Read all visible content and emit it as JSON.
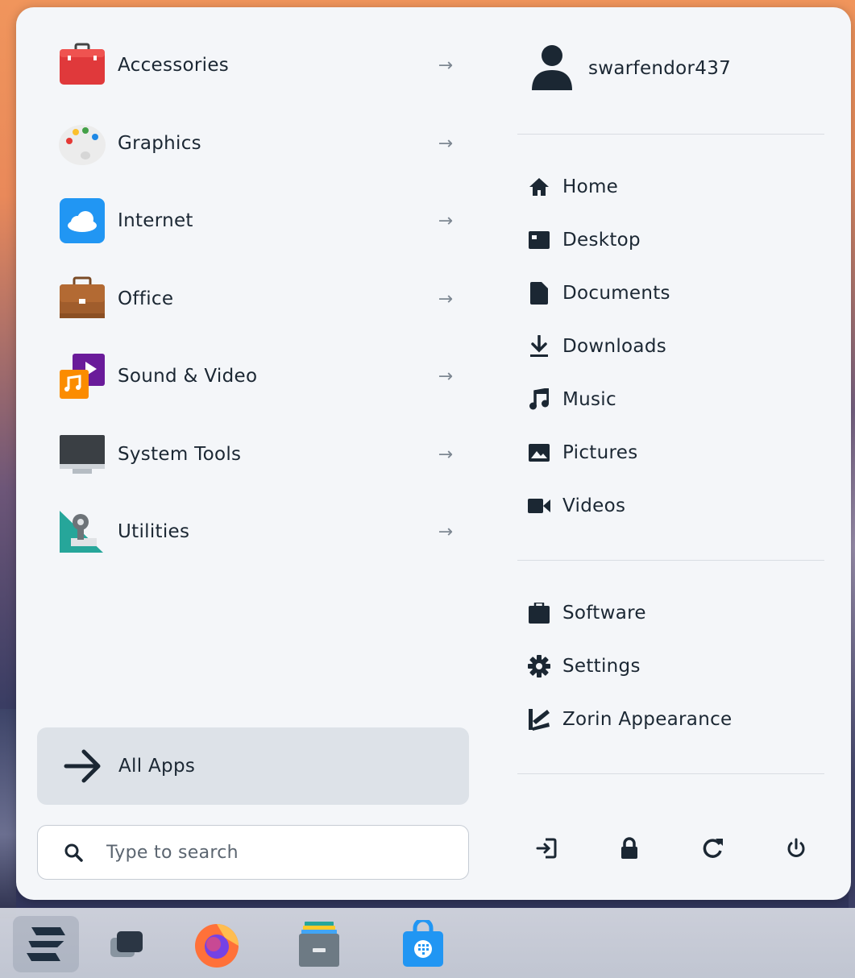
{
  "menu": {
    "categories": [
      {
        "label": "Accessories",
        "icon": "toolbox-icon"
      },
      {
        "label": "Graphics",
        "icon": "palette-icon"
      },
      {
        "label": "Internet",
        "icon": "cloud-icon"
      },
      {
        "label": "Office",
        "icon": "briefcase-icon"
      },
      {
        "label": "Sound & Video",
        "icon": "media-icon"
      },
      {
        "label": "System Tools",
        "icon": "monitor-icon"
      },
      {
        "label": "Utilities",
        "icon": "utilities-icon"
      }
    ],
    "arrow_glyph": "→",
    "all_apps_label": "All Apps",
    "search_placeholder": "Type to search"
  },
  "user": {
    "name": "swarfendor437"
  },
  "places": [
    {
      "label": "Home",
      "icon": "home-icon"
    },
    {
      "label": "Desktop",
      "icon": "desktop-icon"
    },
    {
      "label": "Documents",
      "icon": "document-icon"
    },
    {
      "label": "Downloads",
      "icon": "download-icon"
    },
    {
      "label": "Music",
      "icon": "music-icon"
    },
    {
      "label": "Pictures",
      "icon": "picture-icon"
    },
    {
      "label": "Videos",
      "icon": "video-icon"
    }
  ],
  "system": [
    {
      "label": "Software",
      "icon": "software-icon"
    },
    {
      "label": "Settings",
      "icon": "gear-icon"
    },
    {
      "label": "Zorin Appearance",
      "icon": "zorin-appearance-icon"
    }
  ],
  "power_actions": [
    "logout-icon",
    "lock-icon",
    "restart-icon",
    "power-icon"
  ],
  "taskbar": [
    "zorin-menu-icon",
    "workspaces-icon",
    "firefox-icon",
    "files-icon",
    "software-store-icon"
  ],
  "colors": {
    "panel": "#f4f6f9",
    "text": "#1b2733",
    "icon_dark": "#1b2733",
    "all_apps_bg": "#dde2e8"
  }
}
